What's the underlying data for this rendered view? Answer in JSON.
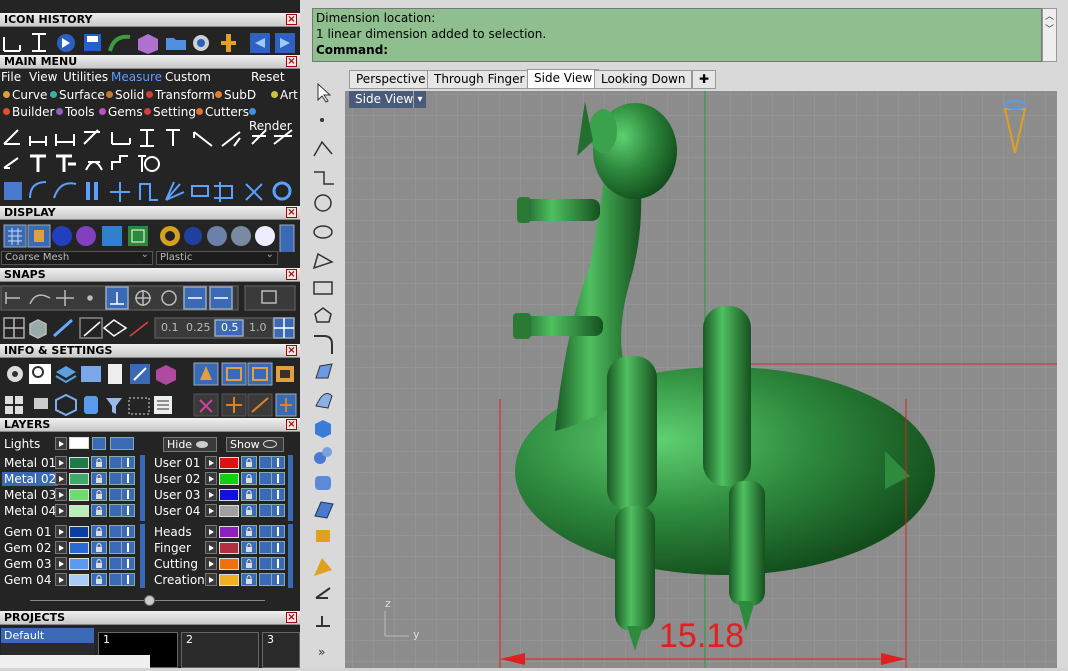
{
  "panels": {
    "icon_history": "ICON HISTORY",
    "main_menu": "MAIN MENU",
    "display": "DISPLAY",
    "snaps": "SNAPS",
    "info_settings": "INFO & SETTINGS",
    "layers": "LAYERS",
    "projects": "PROJECTS"
  },
  "menu": {
    "items": [
      "File",
      "View",
      "Utilities",
      "Measure",
      "Custom",
      "Reset"
    ],
    "selected": "Measure"
  },
  "categories_row1": [
    {
      "label": "Curve",
      "color": "#d8a040"
    },
    {
      "label": "Surface",
      "color": "#40b0a0"
    },
    {
      "label": "Solid",
      "color": "#c07a30"
    },
    {
      "label": "Transform",
      "color": "#d04030"
    },
    {
      "label": "SubD",
      "color": "#e08020"
    },
    {
      "label": "Art",
      "color": "#d0c040"
    }
  ],
  "categories_row2": [
    {
      "label": "Builder",
      "color": "#e05030"
    },
    {
      "label": "Tools",
      "color": "#9060c0"
    },
    {
      "label": "Gems",
      "color": "#c050c0"
    },
    {
      "label": "Setting",
      "color": "#d04040"
    },
    {
      "label": "Cutters",
      "color": "#e07030"
    },
    {
      "label": "Render",
      "color": "#4090e0"
    }
  ],
  "display": {
    "mesh_value": "Coarse Mesh",
    "material_value": "Plastic"
  },
  "snaps": {
    "values": [
      "0.1",
      "0.25",
      "0.5",
      "1.0"
    ],
    "active": "0.5"
  },
  "layers": {
    "lights_label": "Lights",
    "hide_label": "Hide",
    "show_label": "Show",
    "left": [
      {
        "name": "Metal 01",
        "color": "#1f7a4a"
      },
      {
        "name": "Metal 02",
        "color": "#3fa86a"
      },
      {
        "name": "Metal 03",
        "color": "#6fdc6f"
      },
      {
        "name": "Metal 04",
        "color": "#b6f0b6"
      },
      {
        "name": "Gem 01",
        "color": "#0a3fa0"
      },
      {
        "name": "Gem 02",
        "color": "#2a6ad0"
      },
      {
        "name": "Gem 03",
        "color": "#5a9af0"
      },
      {
        "name": "Gem 04",
        "color": "#a8ccf8"
      }
    ],
    "right": [
      {
        "name": "User 01",
        "color": "#e01010"
      },
      {
        "name": "User 02",
        "color": "#10d010"
      },
      {
        "name": "User 03",
        "color": "#1010e0"
      },
      {
        "name": "User 04",
        "color": "#a0a0a0"
      },
      {
        "name": "Heads",
        "color": "#8a20c0"
      },
      {
        "name": "Finger",
        "color": "#b03040"
      },
      {
        "name": "Cutting",
        "color": "#f07010"
      },
      {
        "name": "Creation",
        "color": "#f0b020"
      }
    ],
    "selected": "Metal 02"
  },
  "projects": {
    "default_label": "Default",
    "tabs": [
      "1",
      "2",
      "3"
    ]
  },
  "command": {
    "line1": "Dimension location:",
    "line2": "1 linear dimension added to selection.",
    "prompt": "Command:"
  },
  "viewport_tabs": [
    "Perspective",
    "Through Finger",
    "Side View",
    "Looking Down"
  ],
  "active_tab": "Side View",
  "viewport": {
    "name": "Side View",
    "dimension": "15.18",
    "axis_z": "z",
    "axis_y": "y"
  },
  "colors": {
    "model": "#2e8b3e",
    "command_bg": "#8fbf8f",
    "dimension": "#e02020"
  }
}
